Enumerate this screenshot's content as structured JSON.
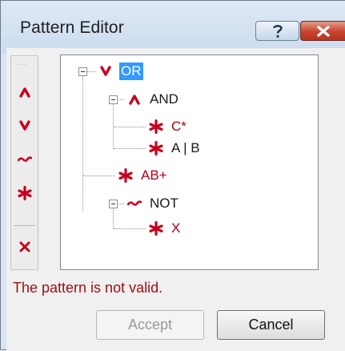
{
  "window": {
    "title": "Pattern Editor",
    "help_label": "?",
    "close_label": "✕"
  },
  "palette": {
    "items": [
      {
        "name": "and-operator",
        "glyph": "^"
      },
      {
        "name": "or-operator",
        "glyph": "v"
      },
      {
        "name": "not-operator",
        "glyph": "~"
      },
      {
        "name": "pattern",
        "glyph": "*"
      },
      {
        "name": "delete",
        "glyph": "x"
      }
    ]
  },
  "tree": {
    "nodes": [
      {
        "label": "OR",
        "type": "or",
        "selected": true
      },
      {
        "label": "AND",
        "type": "and"
      },
      {
        "label": "C*",
        "type": "pattern"
      },
      {
        "label": "A | B",
        "type": "pattern"
      },
      {
        "label": "AB+",
        "type": "pattern"
      },
      {
        "label": "NOT",
        "type": "not"
      },
      {
        "label": "X",
        "type": "pattern"
      }
    ]
  },
  "status": {
    "message": "The pattern is not valid."
  },
  "buttons": {
    "accept_label": "Accept",
    "accept_enabled": false,
    "cancel_label": "Cancel"
  },
  "colors": {
    "operator_red": "#c8001e",
    "error_text": "#9c0e14",
    "selection": "#3399ff"
  }
}
